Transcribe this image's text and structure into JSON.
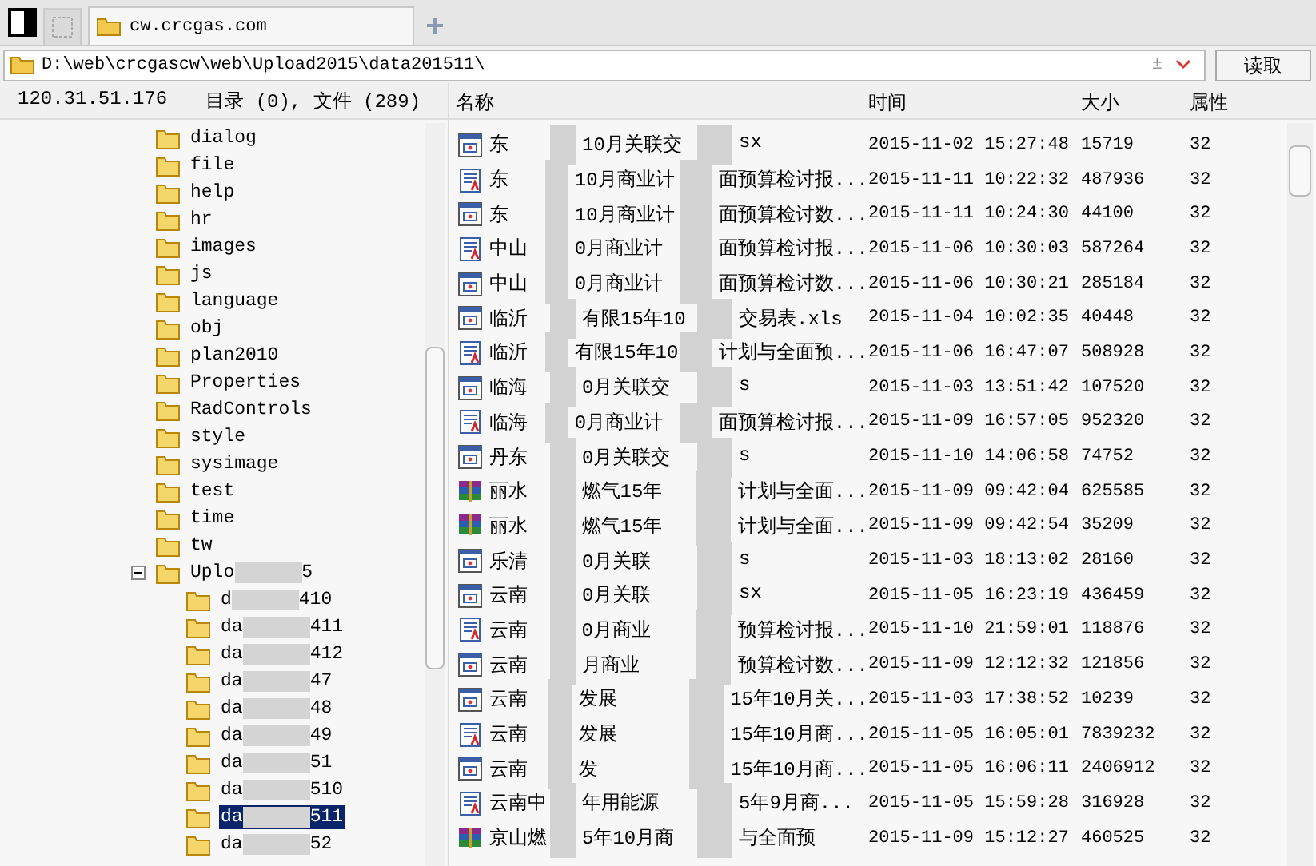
{
  "tabs": [
    {
      "label": "cw.crcgas.com",
      "selected": true
    }
  ],
  "address": {
    "path": "D:\\web\\crcgascw\\web\\Upload2015\\data201511\\",
    "plusminus": "±",
    "button": "读取"
  },
  "info": {
    "host": "120.31.51.176",
    "counts": "目录 (0), 文件 (289)"
  },
  "columns": [
    "名称",
    "时间",
    "大小",
    "属性"
  ],
  "tree": [
    {
      "parts": [
        "dialog"
      ],
      "selected": false
    },
    {
      "parts": [
        "file"
      ],
      "selected": false
    },
    {
      "parts": [
        "help"
      ],
      "selected": false
    },
    {
      "parts": [
        "hr"
      ],
      "selected": false
    },
    {
      "parts": [
        "images"
      ],
      "selected": false
    },
    {
      "parts": [
        "js"
      ],
      "selected": false
    },
    {
      "parts": [
        "language"
      ],
      "selected": false
    },
    {
      "parts": [
        "obj"
      ],
      "selected": false
    },
    {
      "parts": [
        "plan2010"
      ],
      "selected": false
    },
    {
      "parts": [
        "Properties"
      ],
      "selected": false
    },
    {
      "parts": [
        "RadControls"
      ],
      "selected": false
    },
    {
      "parts": [
        "style"
      ],
      "selected": false
    },
    {
      "parts": [
        "sysimage"
      ],
      "selected": false
    },
    {
      "parts": [
        "test"
      ],
      "selected": false
    },
    {
      "parts": [
        "time"
      ],
      "selected": false
    },
    {
      "parts": [
        "tw"
      ],
      "selected": false
    },
    {
      "parts": [
        "Uplo",
        "5"
      ],
      "selected": false,
      "expanded": true,
      "children": [
        {
          "parts": [
            "d",
            "410"
          ],
          "selected": false
        },
        {
          "parts": [
            "da",
            "411"
          ],
          "selected": false
        },
        {
          "parts": [
            "da",
            "412"
          ],
          "selected": false
        },
        {
          "parts": [
            "da",
            "47"
          ],
          "selected": false
        },
        {
          "parts": [
            "da",
            "48"
          ],
          "selected": false
        },
        {
          "parts": [
            "da",
            "49"
          ],
          "selected": false
        },
        {
          "parts": [
            "da",
            "51"
          ],
          "selected": false
        },
        {
          "parts": [
            "da",
            "510"
          ],
          "selected": false
        },
        {
          "parts": [
            "da",
            "511"
          ],
          "selected": true
        },
        {
          "parts": [
            "da",
            "52"
          ],
          "selected": false
        }
      ]
    }
  ],
  "files": [
    {
      "kind": "xls",
      "parts": [
        "东",
        "10月关联交",
        "sx"
      ],
      "time": "2015-11-02 15:27:48",
      "size": "15719",
      "attr": "32"
    },
    {
      "kind": "doc",
      "parts": [
        "东",
        "10月商业计",
        "面预算检讨报..."
      ],
      "time": "2015-11-11 10:22:32",
      "size": "487936",
      "attr": "32"
    },
    {
      "kind": "xls",
      "parts": [
        "东",
        "10月商业计",
        "面预算检讨数..."
      ],
      "time": "2015-11-11 10:24:30",
      "size": "44100",
      "attr": "32"
    },
    {
      "kind": "doc",
      "parts": [
        "中山",
        "0月商业计",
        "面预算检讨报..."
      ],
      "time": "2015-11-06 10:30:03",
      "size": "587264",
      "attr": "32"
    },
    {
      "kind": "xls",
      "parts": [
        "中山",
        "0月商业计",
        "面预算检讨数..."
      ],
      "time": "2015-11-06 10:30:21",
      "size": "285184",
      "attr": "32"
    },
    {
      "kind": "xls",
      "parts": [
        "临沂",
        "有限15年10",
        "交易表.xls"
      ],
      "time": "2015-11-04 10:02:35",
      "size": "40448",
      "attr": "32"
    },
    {
      "kind": "doc",
      "parts": [
        "临沂",
        "有限15年10",
        "计划与全面预..."
      ],
      "time": "2015-11-06 16:47:07",
      "size": "508928",
      "attr": "32"
    },
    {
      "kind": "xls",
      "parts": [
        "临海",
        "0月关联交",
        "s"
      ],
      "time": "2015-11-03 13:51:42",
      "size": "107520",
      "attr": "32"
    },
    {
      "kind": "doc",
      "parts": [
        "临海",
        "0月商业计",
        "面预算检讨报..."
      ],
      "time": "2015-11-09 16:57:05",
      "size": "952320",
      "attr": "32"
    },
    {
      "kind": "xls",
      "parts": [
        "丹东",
        "0月关联交",
        "s"
      ],
      "time": "2015-11-10 14:06:58",
      "size": "74752",
      "attr": "32"
    },
    {
      "kind": "rar",
      "parts": [
        "丽水",
        "燃气15年",
        "计划与全面..."
      ],
      "time": "2015-11-09 09:42:04",
      "size": "625585",
      "attr": "32"
    },
    {
      "kind": "rar",
      "parts": [
        "丽水",
        "燃气15年",
        "计划与全面..."
      ],
      "time": "2015-11-09 09:42:54",
      "size": "35209",
      "attr": "32"
    },
    {
      "kind": "xls",
      "parts": [
        "乐清",
        "0月关联",
        "s"
      ],
      "time": "2015-11-03 18:13:02",
      "size": "28160",
      "attr": "32"
    },
    {
      "kind": "xls",
      "parts": [
        "云南",
        "0月关联",
        "sx"
      ],
      "time": "2015-11-05 16:23:19",
      "size": "436459",
      "attr": "32"
    },
    {
      "kind": "doc",
      "parts": [
        "云南",
        "0月商业",
        "预算检讨报..."
      ],
      "time": "2015-11-10 21:59:01",
      "size": "118876",
      "attr": "32"
    },
    {
      "kind": "xls",
      "parts": [
        "云南",
        "月商业",
        "预算检讨数..."
      ],
      "time": "2015-11-09 12:12:32",
      "size": "121856",
      "attr": "32"
    },
    {
      "kind": "xls",
      "parts": [
        "云南",
        "发展",
        "15年10月关..."
      ],
      "time": "2015-11-03 17:38:52",
      "size": "10239",
      "attr": "32"
    },
    {
      "kind": "doc",
      "parts": [
        "云南",
        "发展",
        "15年10月商..."
      ],
      "time": "2015-11-05 16:05:01",
      "size": "7839232",
      "attr": "32"
    },
    {
      "kind": "xls",
      "parts": [
        "云南",
        "发",
        "15年10月商..."
      ],
      "time": "2015-11-05 16:06:11",
      "size": "2406912",
      "attr": "32"
    },
    {
      "kind": "doc",
      "parts": [
        "云南中",
        "年用能源",
        "5年9月商..."
      ],
      "time": "2015-11-05 15:59:28",
      "size": "316928",
      "attr": "32"
    },
    {
      "kind": "rar",
      "parts": [
        "京山燃",
        "5年10月商",
        "与全面预"
      ],
      "time": "2015-11-09 15:12:27",
      "size": "460525",
      "attr": "32"
    }
  ]
}
